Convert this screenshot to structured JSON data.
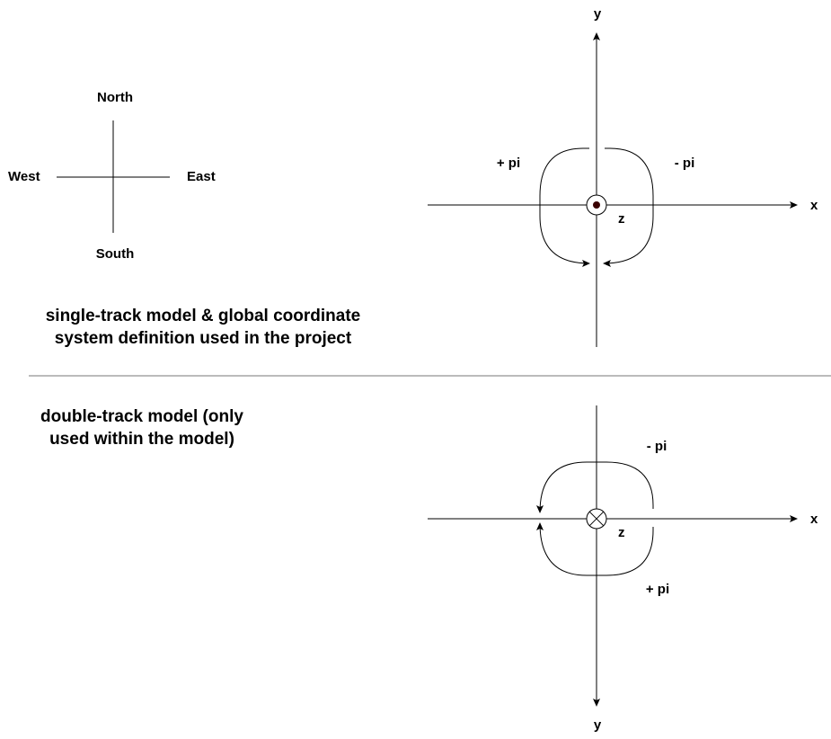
{
  "compass": {
    "north": "North",
    "south": "South",
    "west": "West",
    "east": "East"
  },
  "single_track": {
    "caption_line1": "single-track model & global coordinate",
    "caption_line2": "system definition used in the project",
    "axis_x": "x",
    "axis_y": "y",
    "axis_z": "z",
    "rotation_left": "+ pi",
    "rotation_right": "- pi"
  },
  "double_track": {
    "caption_line1": "double-track model (only",
    "caption_line2": "used within the model)",
    "axis_x": "x",
    "axis_y": "y",
    "axis_z": "z",
    "rotation_top": "- pi",
    "rotation_bottom": "+ pi"
  }
}
